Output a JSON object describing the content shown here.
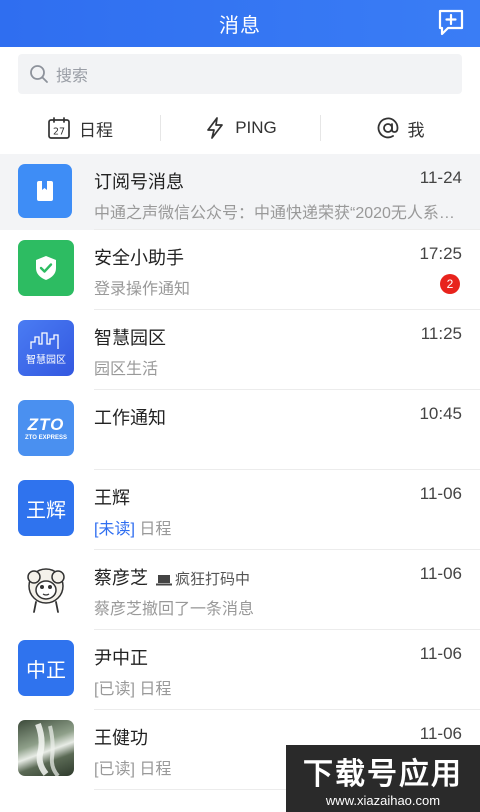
{
  "header": {
    "title": "消息"
  },
  "search": {
    "placeholder": "搜索"
  },
  "quick_actions": [
    {
      "label": "日程",
      "icon": "calendar-icon"
    },
    {
      "label": "PING",
      "icon": "lightning-icon"
    },
    {
      "label": "我",
      "icon": "at-icon"
    }
  ],
  "calendar_day": "27",
  "conversations": [
    {
      "name": "订阅号消息",
      "time": "11-24",
      "preview": "中通之声微信公众号：中通快递荣获“2020无人系…",
      "avatar_color": "#3e8df6",
      "icon": "bookmark-icon"
    },
    {
      "name": "安全小助手",
      "time": "17:25",
      "preview": "登录操作通知",
      "avatar_color": "#2dbc62",
      "icon": "shield-check-icon",
      "unread": "2"
    },
    {
      "name": "智慧园区",
      "time": "11:25",
      "preview": "园区生活",
      "avatar_color": "#3b6cf0",
      "icon": "city-skyline-icon",
      "avatar_text": "智慧园区"
    },
    {
      "name": "工作通知",
      "time": "10:45",
      "preview": "",
      "avatar_color": "#4a90f0",
      "icon": "zto-logo-icon",
      "avatar_text": "ZTO",
      "avatar_subtext": "ZTO EXPRESS"
    },
    {
      "name": "王辉",
      "time": "11-06",
      "read_tag": "[未读]",
      "preview": "日程",
      "avatar_color": "#2f73ee",
      "avatar_text": "王辉"
    },
    {
      "name": "蔡彦芝",
      "status": "疯狂打码中",
      "time": "11-06",
      "preview": "蔡彦芝撤回了一条消息",
      "avatar_color": "#ffffff",
      "icon": "sheep-avatar-icon"
    },
    {
      "name": "尹中正",
      "time": "11-06",
      "read_tag": "[已读]",
      "preview": "日程",
      "avatar_color": "#2f73ee",
      "avatar_text": "中正"
    },
    {
      "name": "王健功",
      "time": "11-06",
      "read_tag": "[已读]",
      "preview": "日程",
      "avatar_color": "#5a6e5a",
      "icon": "waterfall-photo-icon"
    }
  ],
  "watermark": {
    "title": "下载号应用",
    "url": "www.xiazaihao.com"
  }
}
